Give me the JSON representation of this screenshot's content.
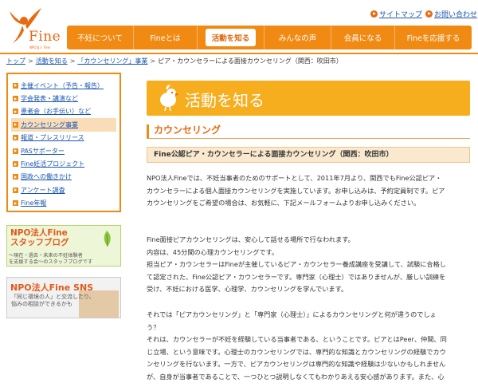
{
  "header": {
    "logo_text": "Fine",
    "logo_sub": "NPO法人 Fine",
    "util_links": [
      "サイトマップ",
      "お問い合わせ"
    ],
    "nav": [
      {
        "label": "不妊について",
        "active": false
      },
      {
        "label": "Fineとは",
        "active": false
      },
      {
        "label": "活動を知る",
        "active": true
      },
      {
        "label": "みんなの声",
        "active": false
      },
      {
        "label": "会員になる",
        "active": false
      },
      {
        "label": "Fineを応援する",
        "active": false
      }
    ],
    "colors": {
      "accent": "#f18a13",
      "link": "#1a56b0"
    }
  },
  "breadcrumb": {
    "items": [
      "トップ",
      "活動を知る",
      "「カウンセリング」事業"
    ],
    "current": "ピア・カウンセラーによる面接カウンセリング（関西：吹田市）",
    "separator": ">"
  },
  "sidebar": {
    "items": [
      {
        "label": "主催イベント（予告・報告）",
        "active": false
      },
      {
        "label": "学会発表・講演など",
        "active": false
      },
      {
        "label": "患者会（お手伝い）など",
        "active": false
      },
      {
        "label": "カウンセリング事業",
        "active": true
      },
      {
        "label": "報道・プレスリリース",
        "active": false
      },
      {
        "label": "PASサポーター",
        "active": false
      },
      {
        "label": "Fine妊活プロジェクト",
        "active": false
      },
      {
        "label": "国政への働きかけ",
        "active": false
      },
      {
        "label": "アンケート調査",
        "active": false
      },
      {
        "label": "Fine年報",
        "active": false
      }
    ],
    "banner_blog": {
      "title_line1": "NPO法人Fine",
      "title_line2": "スタッフブログ",
      "sub_line1": "〜現在・過去・未来の不妊体験者",
      "sub_line2": "を支援する会〜のスタッフブログです"
    },
    "banner_sns": {
      "title": "NPO法人Fine SNS",
      "sub_line1": "「同じ環境の人」と交流したり、",
      "sub_line2": "悩みの相談ができるかも"
    }
  },
  "main": {
    "banner_title": "活動を知る",
    "section_title": "カウンセリング",
    "sub_title": "Fine公認ピア・カウンセラーによる面接カウンセリング（関西：吹田市）",
    "paragraphs": [
      {
        "lines": [
          "NPO法人Fineでは、不妊当事者のためのサポートとして、2011年7月より、関西でもFine公認ピア・",
          "カウンセラーによる個人面接カウンセリングを実施しています。お申し込みは、予約定員制です。ピア",
          "カウンセリングをご希望の場合は、お気軽に、下記メールフォームよりお申し込みください。"
        ]
      },
      {
        "lines": [
          "Fine面接ピアカウンセリングは、安心して話せる場所で行なわれます。",
          "内容は、45分間の心理カウンセリングです。",
          "担当ピア・カウンセラーはFineが主催しているピア・カウンセラー養成講座を受講して、試験に合格し",
          "て認定された、Fine公認ピア・カウンセラーです。専門家（心理士）ではありませんが、厳しい訓練を",
          "受け、不妊における医学、心理学、カウンセリングを学んでいます。"
        ]
      },
      {
        "lines": [
          "それでは「ピアカウンセリング」と「専門家（心理士）」によるカウンセリングと何が違うのでしょ",
          "う？",
          "それは、カウンセラーが不妊を経験している当事者である、ということです。ピアとはPeer、仲間、同",
          "じ立場、という意味です。心理士のカウンセリングでは、専門的な知識とカウンセリングの経験でカウ",
          "ンセリングを行ないます。一方で、ピアカウンセリングは専門的な知識や経験は少ないかもしれません",
          "が、自身が当事者であることで、一つひとつ説明しなくてもわかりあえる安心感があります。また、心"
        ]
      }
    ]
  }
}
